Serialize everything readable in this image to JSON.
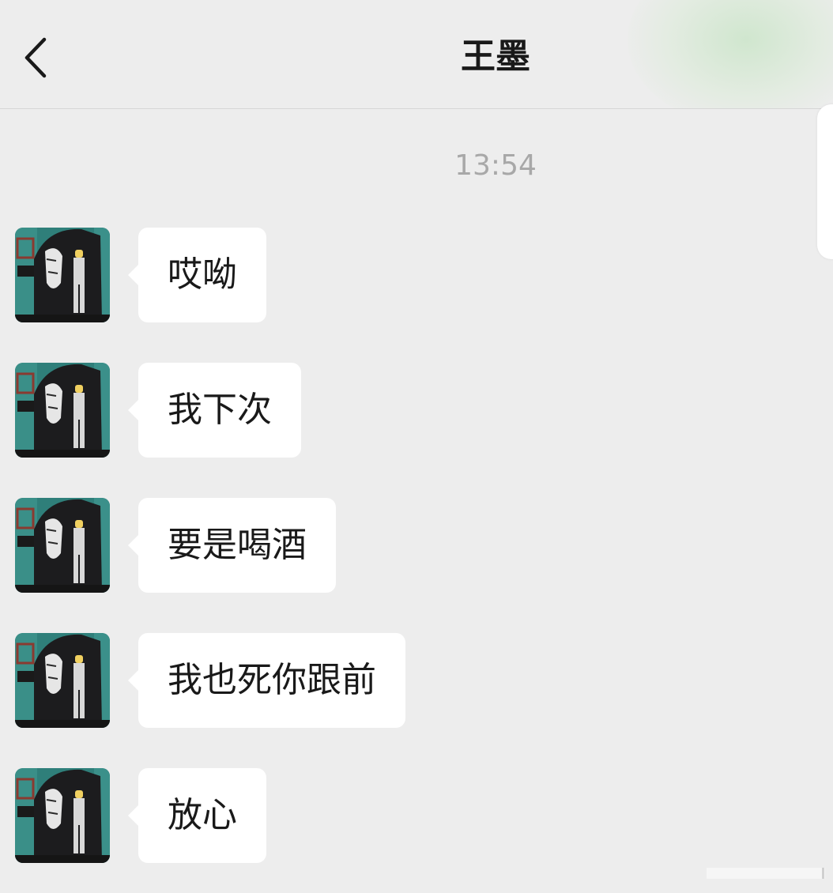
{
  "header": {
    "title": "王墨",
    "back_icon": "chevron-left-icon"
  },
  "chat": {
    "timestamp": "13:54",
    "messages": [
      {
        "sender": "王墨",
        "text": "哎呦"
      },
      {
        "sender": "王墨",
        "text": "我下次"
      },
      {
        "sender": "王墨",
        "text": "要是喝酒"
      },
      {
        "sender": "王墨",
        "text": "我也死你跟前"
      },
      {
        "sender": "王墨",
        "text": "放心"
      }
    ]
  },
  "colors": {
    "background": "#ededed",
    "bubble": "#ffffff",
    "text": "#191919",
    "timestamp": "#a8a8a8",
    "avatar_mural": "#2f7f7a"
  }
}
